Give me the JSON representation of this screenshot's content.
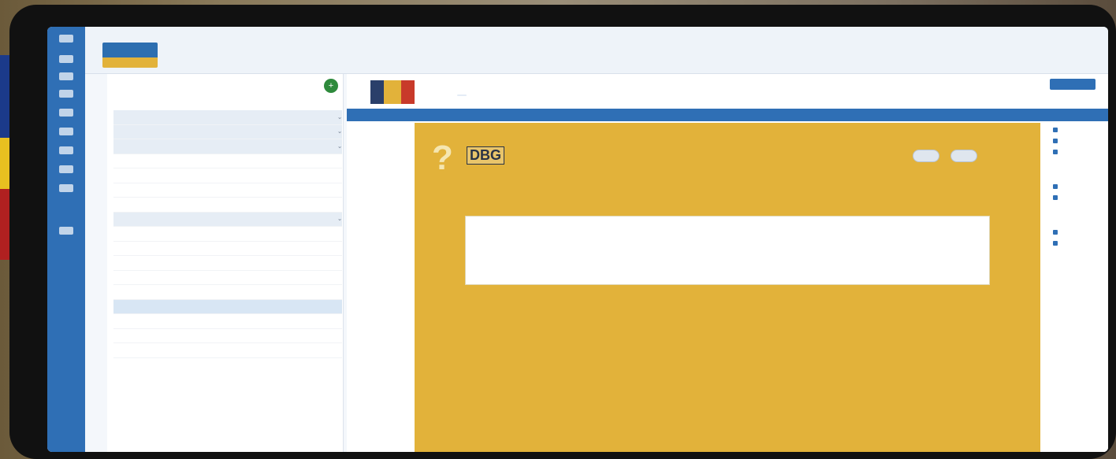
{
  "header": {
    "crumb": "",
    "course_title": "",
    "topbar_link": ""
  },
  "logo": {
    "text": ""
  },
  "left_panel": {
    "search_placeholder": "",
    "add_label": "+",
    "rows": [
      {
        "type": "unit",
        "c1": "",
        "c2": ""
      },
      {
        "type": "unit",
        "c1": "",
        "c2": ""
      },
      {
        "type": "unit",
        "c1": "",
        "c2": ""
      },
      {
        "type": "child",
        "c1": "",
        "c2": ""
      },
      {
        "type": "child",
        "c1": "",
        "c2": ""
      },
      {
        "type": "child",
        "c1": "",
        "c2": ""
      },
      {
        "type": "child",
        "c1": "",
        "c2": ""
      },
      {
        "type": "unit",
        "c1": "",
        "c2": ""
      },
      {
        "type": "child",
        "c1": "",
        "c2": ""
      },
      {
        "type": "child",
        "c1": "",
        "c2": ""
      },
      {
        "type": "child",
        "c1": "",
        "c2": ""
      },
      {
        "type": "child",
        "c1": "",
        "c2": ""
      },
      {
        "type": "child",
        "c1": "",
        "c2": ""
      },
      {
        "type": "child-selected",
        "c1": "",
        "c2": ""
      },
      {
        "type": "child",
        "c1": "",
        "c2": ""
      },
      {
        "type": "child",
        "c1": "",
        "c2": ""
      },
      {
        "type": "child",
        "c1": "",
        "c2": ""
      }
    ]
  },
  "main": {
    "lesson_title": "",
    "lesson_chip": "",
    "pager": "",
    "primary_button": "",
    "bluebar_title": "",
    "bluebar_close": "",
    "card": {
      "link": "",
      "mark": "?",
      "label": "DBG",
      "question": "",
      "hint": "",
      "editor_toolbar": "",
      "editor_placeholder": "",
      "char_count": ""
    }
  },
  "right_panel": {
    "sections": [
      {
        "heading": "",
        "items": [
          "",
          "",
          ""
        ]
      },
      {
        "heading": "",
        "items": [
          "",
          ""
        ]
      },
      {
        "heading": "",
        "items": [
          "",
          ""
        ]
      }
    ]
  },
  "colors": {
    "brand_blue": "#2f6fb5",
    "card_gold": "#e2b23a",
    "add_green": "#2e8a3c"
  }
}
